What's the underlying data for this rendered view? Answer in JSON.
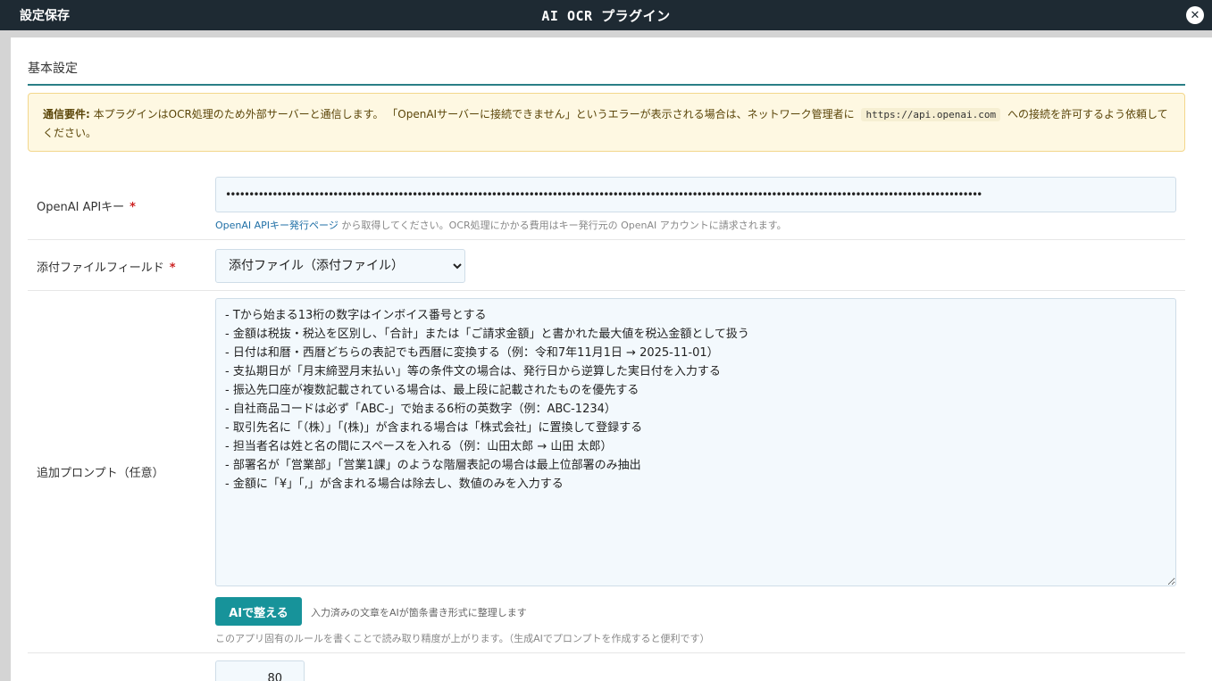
{
  "header": {
    "save_label": "設定保存",
    "title": "AI OCR プラグイン",
    "close_glyph": "✕"
  },
  "section": {
    "title": "基本設定"
  },
  "notice": {
    "label": "通信要件:",
    "text1": "本プラグインはOCR処理のため外部サーバーと通信します。 「OpenAIサーバーに接続できません」というエラーが表示される場合は、ネットワーク管理者に",
    "url": "https://api.openai.com",
    "text2": "への接続を許可するよう依頼してください。"
  },
  "api_key": {
    "label": "OpenAI APIキー",
    "required_mark": "*",
    "value": "••••••••••••••••••••••••••••••••••••••••••••••••••••••••••••••••••••••••••••••••••••••••••••••••••••••••••••••••••••••••••••••••••••••••••••••••••••••••••••••••••",
    "help_link": "OpenAI APIキー発行ページ",
    "help_text": " から取得してください。OCR処理にかかる費用はキー発行元の OpenAI アカウントに請求されます。"
  },
  "attachment": {
    "label": "添付ファイルフィールド",
    "required_mark": "*",
    "selected": "添付ファイル（添付ファイル）"
  },
  "prompt": {
    "label": "追加プロンプト（任意）",
    "value": "- Tから始まる13桁の数字はインボイス番号とする\n- 金額は税抜・税込を区別し、「合計」または「ご請求金額」と書かれた最大値を税込金額として扱う\n- 日付は和暦・西暦どちらの表記でも西暦に変換する（例：令和7年11月1日 → 2025-11-01）\n- 支払期日が「月末締翌月末払い」等の条件文の場合は、発行日から逆算した実日付を入力する\n- 振込先口座が複数記載されている場合は、最上段に記載されたものを優先する\n- 自社商品コードは必ず「ABC-」で始まる6桁の英数字（例：ABC-1234）\n- 取引先名に「（株）」「(株)」が含まれる場合は「株式会社」に置換して登録する\n- 担当者名は姓と名の間にスペースを入れる（例：山田太郎 → 山田 太郎）\n- 部署名が「営業部」「営業1課」のような階層表記の場合は最上位部署のみ抽出\n- 金額に「¥」「,」が含まれる場合は除去し、数値のみを入力する",
    "ai_button": "AIで整える",
    "ai_button_desc": "入力済みの文章をAIが箇条書き形式に整理します",
    "help": "このアプリ固有のルールを書くことで読み取り精度が上がります。（生成AIでプロンプトを作成すると便利です）"
  },
  "number_field": {
    "value": "80"
  }
}
